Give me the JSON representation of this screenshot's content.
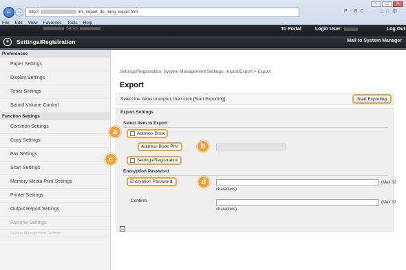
{
  "browser": {
    "url_prefix": "http://",
    "url_suffix": "/rm_import_do_ming_export.html",
    "search_hint": "P - B C",
    "menu": [
      "File",
      "Edit",
      "View",
      "Favorites",
      "Tools",
      "Help"
    ],
    "win_controls": [
      "–",
      "□",
      "✕"
    ]
  },
  "topbar": {
    "device_name": "Series",
    "portal_link": "To Portal",
    "login_label": "Login User:",
    "logout_label": "Log Out"
  },
  "header": {
    "app_title": "Settings/Registration",
    "mail_link": "Mail to System Manager"
  },
  "sidebar": {
    "section_preferences": "Preferences",
    "preferences_items": [
      "Paper Settings",
      "Display Settings",
      "Timer Settings",
      "Sound Volume Control"
    ],
    "section_function": "Function Settings",
    "function_items": [
      "Common Settings",
      "Copy Settings",
      "Fax Settings",
      "Scan Settings",
      "Memory Media Print Settings",
      "Printer Settings",
      "Output Report Settings",
      "Favorite Settings"
    ],
    "last_item": "System Management Settings"
  },
  "main": {
    "breadcrumb": "Settings/Registration: System Management Settings: Import/Export > Export",
    "title": "Export",
    "instruction": "Select the items to export, then click [Start Exporting].",
    "start_button": "Start Exporting",
    "settings_head": "Export Settings",
    "select_head": "Select Item to Export",
    "address_book_label": "Address Book",
    "address_book_pin_label": "Address Book PIN:",
    "settings_registration_label": "Settings/Registration",
    "encryption_head": "Encryption Password",
    "encryption_label": "Encryption Password:",
    "confirm_label": "Confirm:",
    "max_note_a": "(Max 32",
    "max_note_b": "characters)"
  },
  "badges": {
    "a": "a",
    "b": "b",
    "c": "c",
    "d": "d"
  },
  "colors": {
    "highlight": "#f2a033",
    "header_dark": "#1c1f23"
  }
}
